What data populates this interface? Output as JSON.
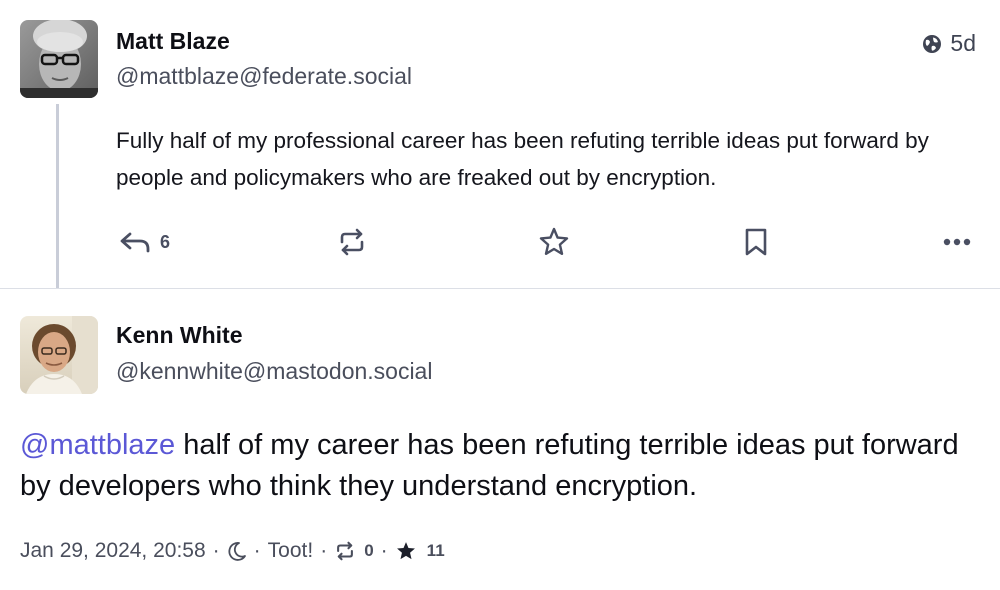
{
  "posts": [
    {
      "author": {
        "display_name": "Matt Blaze",
        "handle": "@mattblaze@federate.social"
      },
      "visibility_icon": "globe-icon",
      "age": "5d",
      "content": "Fully half of my professional career has been refuting terrible ideas put forward by people and policymakers who are freaked out by encryption.",
      "actions": {
        "reply_icon": "reply-icon",
        "reply_count": "6",
        "boost_icon": "boost-icon",
        "favourite_icon": "star-icon",
        "bookmark_icon": "bookmark-icon",
        "more_icon": "more-icon"
      }
    },
    {
      "author": {
        "display_name": "Kenn White",
        "handle": "@kennwhite@mastodon.social"
      },
      "mention": "@mattblaze",
      "content": " half of my career has been refuting terrible ideas put forward by developers who think they understand encryption.",
      "meta": {
        "timestamp": "Jan 29, 2024, 20:58",
        "separator": "·",
        "visibility_icon": "moon-icon",
        "application": "Toot!",
        "boost_icon": "boost-icon",
        "boost_count": "0",
        "favourite_icon": "star-filled-icon",
        "favourite_count": "11"
      }
    }
  ],
  "colors": {
    "mention": "#5b58d6",
    "thread_line": "#c9cdd8",
    "secondary_text": "#4a4e5c",
    "divider": "#dcdfe6"
  }
}
